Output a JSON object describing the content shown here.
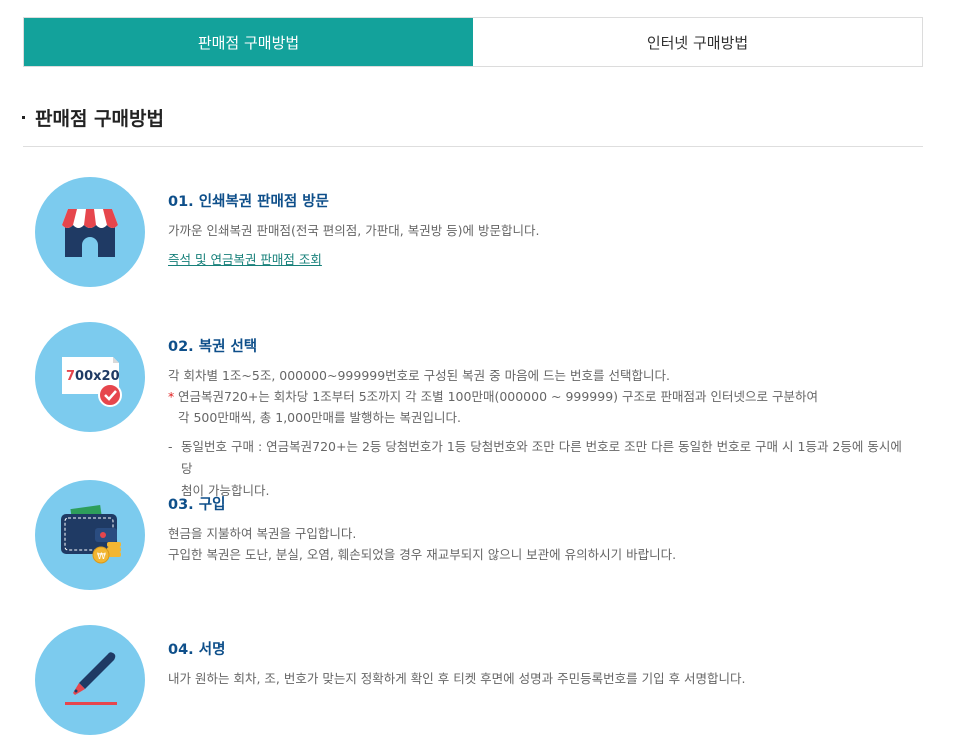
{
  "tabs": [
    {
      "label": "판매점 구매방법",
      "active": true
    },
    {
      "label": "인터넷 구매방법",
      "active": false
    }
  ],
  "section_title": "판매점 구매방법",
  "steps": [
    {
      "icon": "store-icon",
      "title": "01. 인쇄복권 판매점 방문",
      "desc": "가까운 인쇄복권 판매점(전국 편의점, 가판대, 복권방 등)에 방문합니다.",
      "link": "즉석 및 연금복권 판매점 조회"
    },
    {
      "icon": "ticket-icon",
      "icon_text": "700x20",
      "title": "02. 복권 선택",
      "desc": "각 회차별 1조~5조, 000000~999999번호로 구성된 복권 중 마음에 드는 번호를 선택합니다.",
      "note_star": "*",
      "note_line1": "연금복권720+는 회차당 1조부터 5조까지 각 조별 100만매(000000 ~ 999999) 구조로 판매점과 인터넷으로 구분하여",
      "note_line2": "각 500만매씩, 총 1,000만매를 발행하는 복권입니다.",
      "note2_dash": "-",
      "note2_line1": "동일번호 구매 : 연금복권720+는 2등 당첨번호가 1등 당첨번호와 조만 다른 번호로 조만 다른 동일한 번호로 구매 시 1등과 2등에 동시에 당",
      "note2_line2": "첨이 가능합니다."
    },
    {
      "icon": "wallet-icon",
      "title": "03. 구입",
      "desc": "현금을 지불하여 복권을 구입합니다.",
      "desc2": "구입한 복권은 도난, 분실, 오염, 훼손되었을 경우 재교부되지 않으니 보관에 유의하시기 바랍니다."
    },
    {
      "icon": "pen-icon",
      "title": "04. 서명",
      "desc": "내가 원하는 회차, 조, 번호가 맞는지 정확하게 확인 후 티켓 후면에 성명과 주민등록번호를 기입 후 서명합니다."
    }
  ],
  "colors": {
    "accent": "#13a29b",
    "circle": "#7ccbee",
    "title": "#0e4f8a",
    "link": "#17807a"
  }
}
